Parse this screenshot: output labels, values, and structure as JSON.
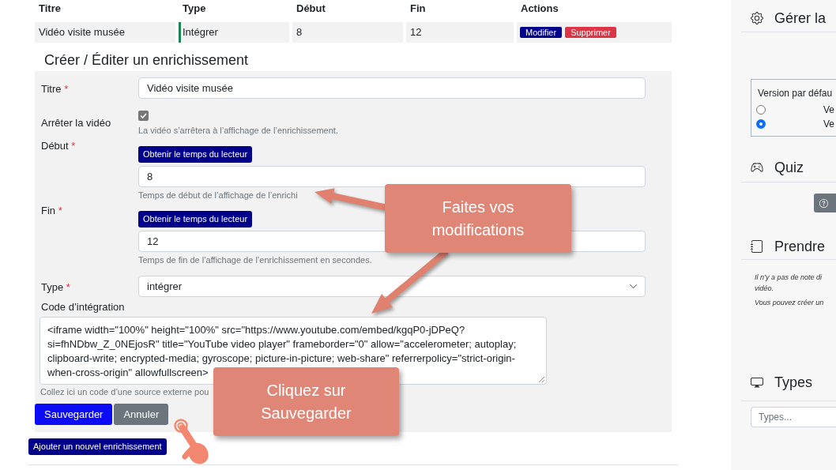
{
  "table": {
    "columns": [
      "Titre",
      "Type",
      "Début",
      "Fin",
      "Actions"
    ],
    "rows": [
      {
        "cells": [
          "Vidéo visite musée",
          "Intégrer",
          "8",
          "12"
        ],
        "actions": [
          {
            "label": "Modifier",
            "kind": "edit"
          },
          {
            "label": "Supprimer",
            "kind": "delete"
          }
        ]
      }
    ]
  },
  "form": {
    "title": "Créer / Éditer un enrichissement",
    "fields": [
      {
        "kind": "text",
        "label": "Titre",
        "mark": "*",
        "value": "Vidéo visite musée"
      },
      {
        "kind": "checkbox",
        "label": "Arrêter la vidéo",
        "checked": true,
        "help": "La vidéo s’arrêtera à l’affichage de l’enrichissement."
      },
      {
        "kind": "time",
        "label": "Début",
        "mark": "*",
        "button": "Obtenir le temps du lecteur",
        "value": "8",
        "help": "Temps de début de l’affichage de l’enrichi"
      },
      {
        "kind": "time",
        "label": "Fin",
        "mark": "*",
        "button": "Obtenir le temps du lecteur",
        "value": "12",
        "help": "Temps de fin de l’affichage de l’enrichissement en secondes."
      },
      {
        "kind": "select",
        "label": "Type",
        "mark": "*",
        "value": "intégrer"
      },
      {
        "kind": "textarea",
        "label": "Code d’intégration",
        "value": "<iframe width=\"100%\" height=\"100%\" src=\"https://www.youtube.com/embed/kgqP0-jDPeQ?si=fhNDbw_Z_0NEjosR\" title=\"YouTube video player\" frameborder=\"0\" allow=\"accelerometer; autoplay; clipboard-write; encrypted-media; gyroscope; picture-in-picture; web-share\" referrerpolicy=\"strict-origin-when-cross-origin\" allowfullscreen>",
        "help": "Collez ici un code d’une source externe pou"
      }
    ],
    "buttons": [
      {
        "label": "Sauvegarder",
        "kind": "primary"
      },
      {
        "label": "Annuler",
        "kind": "secondary"
      }
    ]
  },
  "add_button": "Ajouter un nouvel enrichissement",
  "sidebar": {
    "sections": [
      {
        "kind": "settings",
        "title": "Gérer la",
        "default_version": {
          "label": "Version par défau",
          "options": [
            {
              "label": "Ve",
              "selected": false
            },
            {
              "label": "Ve",
              "selected": true
            }
          ]
        }
      },
      {
        "kind": "quiz",
        "title": "Quiz"
      },
      {
        "kind": "notes",
        "title": "Prendre",
        "paragraphs": [
          {
            "lines": [
              "Il n’y a pas de note di",
              "vidéo."
            ]
          },
          {
            "lines": [
              "Vous pouvez créer un"
            ]
          }
        ]
      },
      {
        "kind": "types",
        "title": "Types",
        "search": {
          "placeholder": "Types..."
        }
      }
    ]
  },
  "annotations": [
    {
      "text": "Faites vos modifications"
    },
    {
      "text": "Cliquez sur Sauvegarder"
    }
  ]
}
